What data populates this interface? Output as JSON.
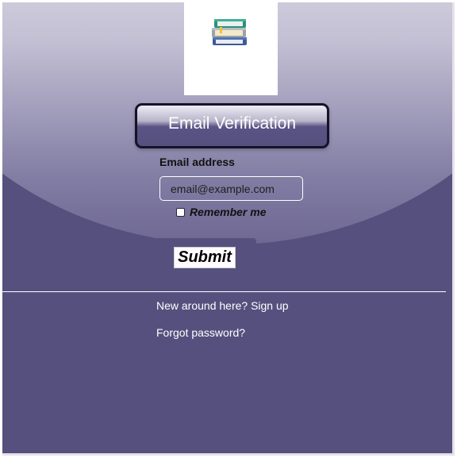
{
  "logo": {
    "icon": "books-stack-icon"
  },
  "header": {
    "title": "Email Verification"
  },
  "form": {
    "email_label": "Email address",
    "email_placeholder": "email@example.com",
    "email_value": "",
    "remember_label": "Remember me",
    "remember_checked": false,
    "submit_label": "Submit"
  },
  "links": {
    "signup": "New around here? Sign up",
    "forgot": "Forgot password?"
  },
  "colors": {
    "background": "#56507e",
    "link": "#ffffff"
  }
}
